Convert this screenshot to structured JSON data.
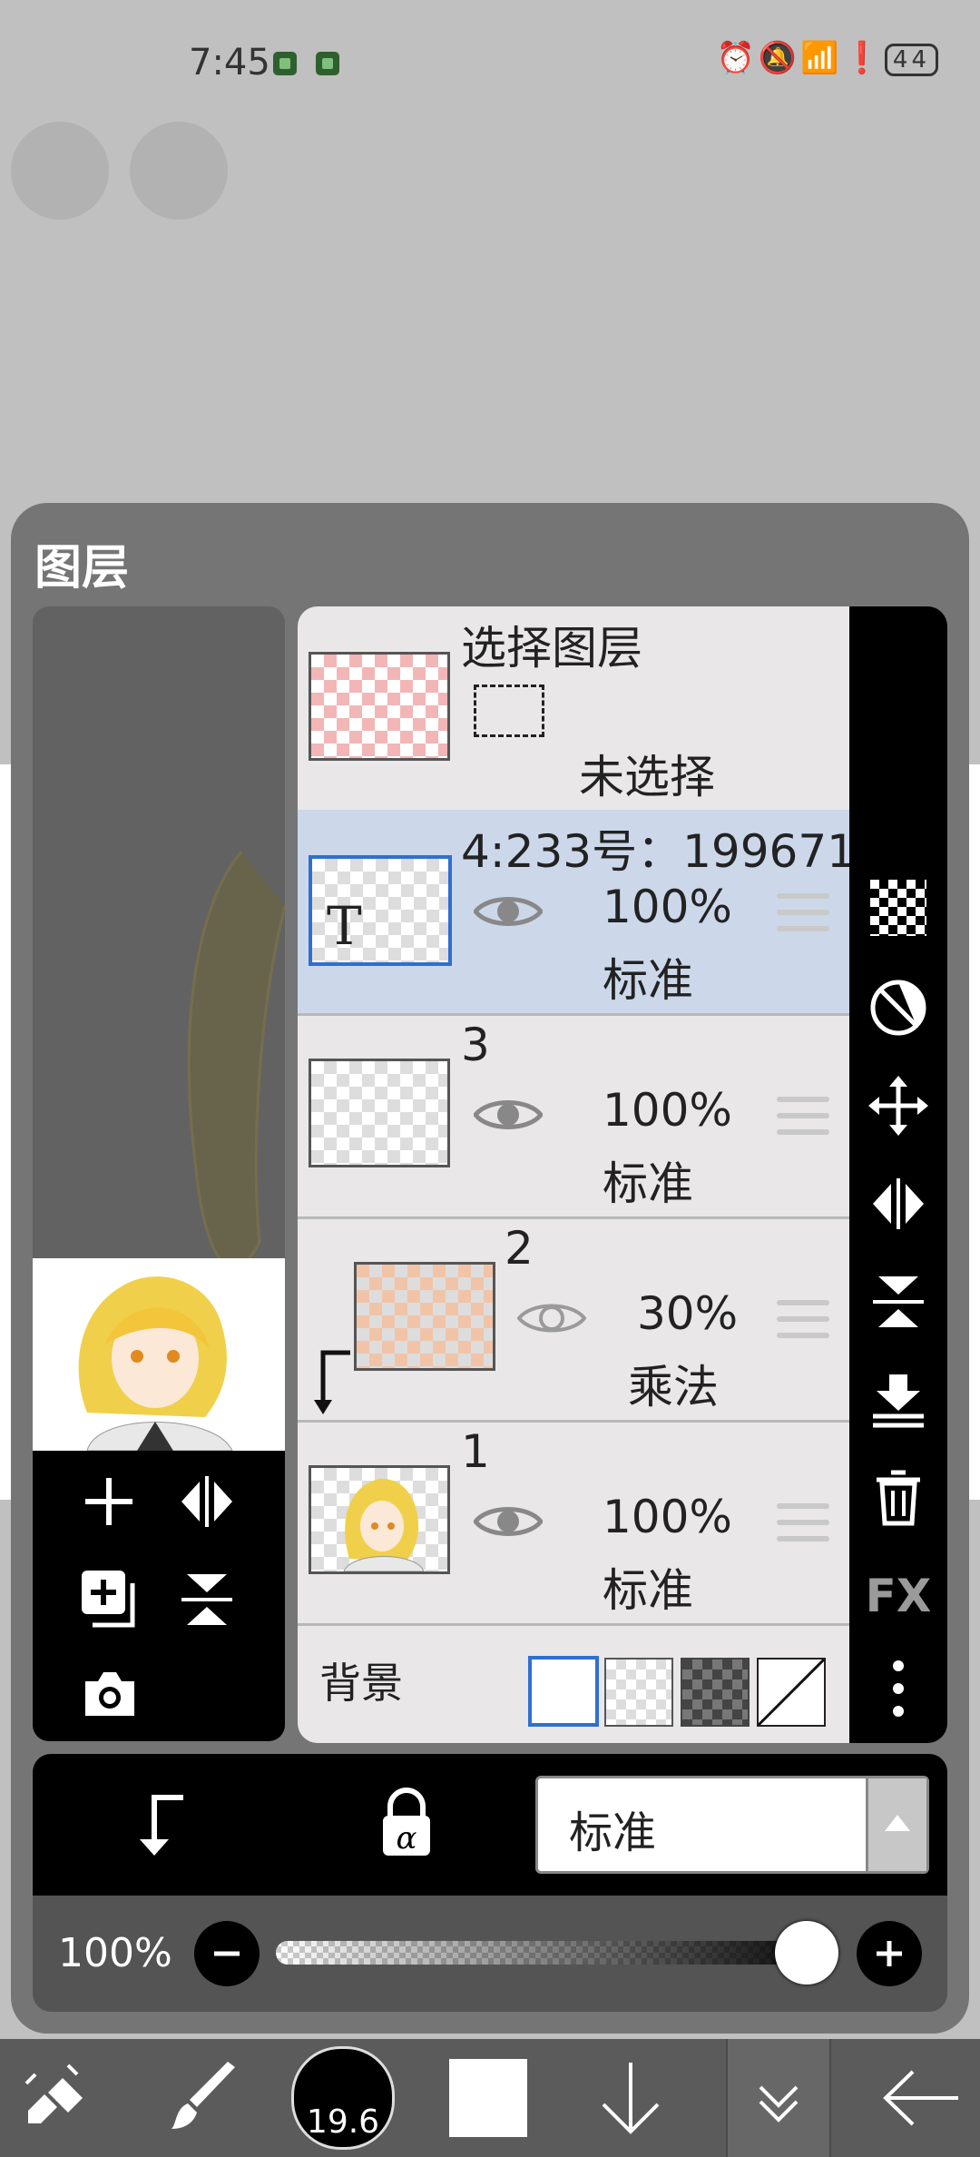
{
  "status_bar": {
    "time": "7:45",
    "battery": "44"
  },
  "panel": {
    "title": "图层"
  },
  "selection_layer": {
    "title": "选择图层",
    "status": "未选择"
  },
  "layers": [
    {
      "name": "4:233号：199671",
      "opacity": "100%",
      "blend": "标准",
      "selected": true
    },
    {
      "name": "3",
      "opacity": "100%",
      "blend": "标准",
      "selected": false
    },
    {
      "name": "2",
      "opacity": "30%",
      "blend": "乘法",
      "selected": false,
      "clipped": true
    },
    {
      "name": "1",
      "opacity": "100%",
      "blend": "标准",
      "selected": false
    }
  ],
  "background": {
    "label": "背景"
  },
  "right_tools": [
    "transparency-icon",
    "invert-icon",
    "move-icon",
    "flip-horizontal-icon",
    "flip-vertical-icon",
    "merge-down-icon",
    "trash-icon",
    "fx-icon",
    "more-icon"
  ],
  "right_tools_fx_label": "FX",
  "blend_bar": {
    "mode": "标准"
  },
  "opacity_bar": {
    "value": "100%",
    "slider_value": 1.0
  },
  "bottom_toolbar": {
    "brush_size": "19.6"
  },
  "colors": {
    "panel": "#757575",
    "selected_row": "#ccd8ea",
    "accent": "#2f6fd0"
  }
}
